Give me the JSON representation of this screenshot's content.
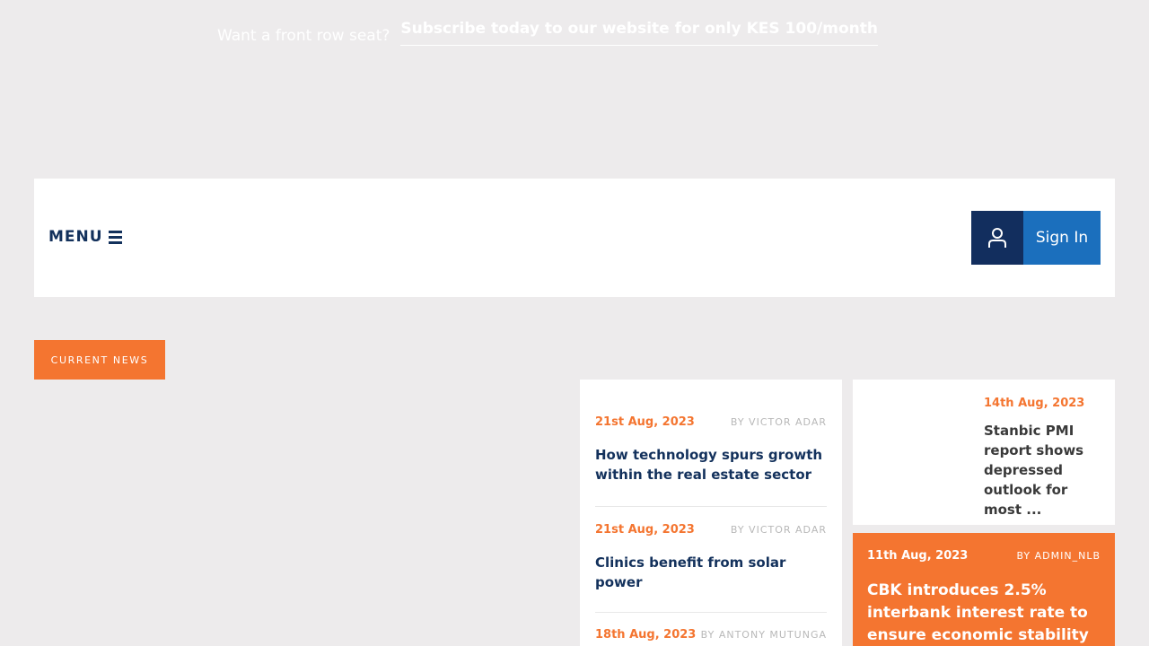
{
  "promo": {
    "label": "Want a front row seat?",
    "link": "Subscribe today to our website for only KES 100/month"
  },
  "header": {
    "menu_label": "MENU",
    "signin_label": "Sign In"
  },
  "section_label": "CURRENT NEWS",
  "news_list": [
    {
      "date": "21st Aug, 2023",
      "author": "BY VICTOR ADAR",
      "title": "How technology spurs growth within the real estate sector"
    },
    {
      "date": "21st Aug, 2023",
      "author": "BY VICTOR ADAR",
      "title": "Clinics benefit from solar power"
    },
    {
      "date": "18th Aug, 2023",
      "author": "BY ANTONY MUTUNGA",
      "title": ""
    }
  ],
  "side_card": {
    "date": "14th Aug, 2023",
    "title": "Stanbic PMI report shows depressed outlook for most ..."
  },
  "feature_card": {
    "date": "11th Aug, 2023",
    "author": "BY ADMIN_NLB",
    "title": "CBK introduces 2.5% interbank interest rate to ensure economic stability"
  },
  "colors": {
    "accent": "#f47530",
    "navy": "#13315c",
    "signin_blue": "#1b6fbd",
    "signin_dark": "#122e5e"
  }
}
